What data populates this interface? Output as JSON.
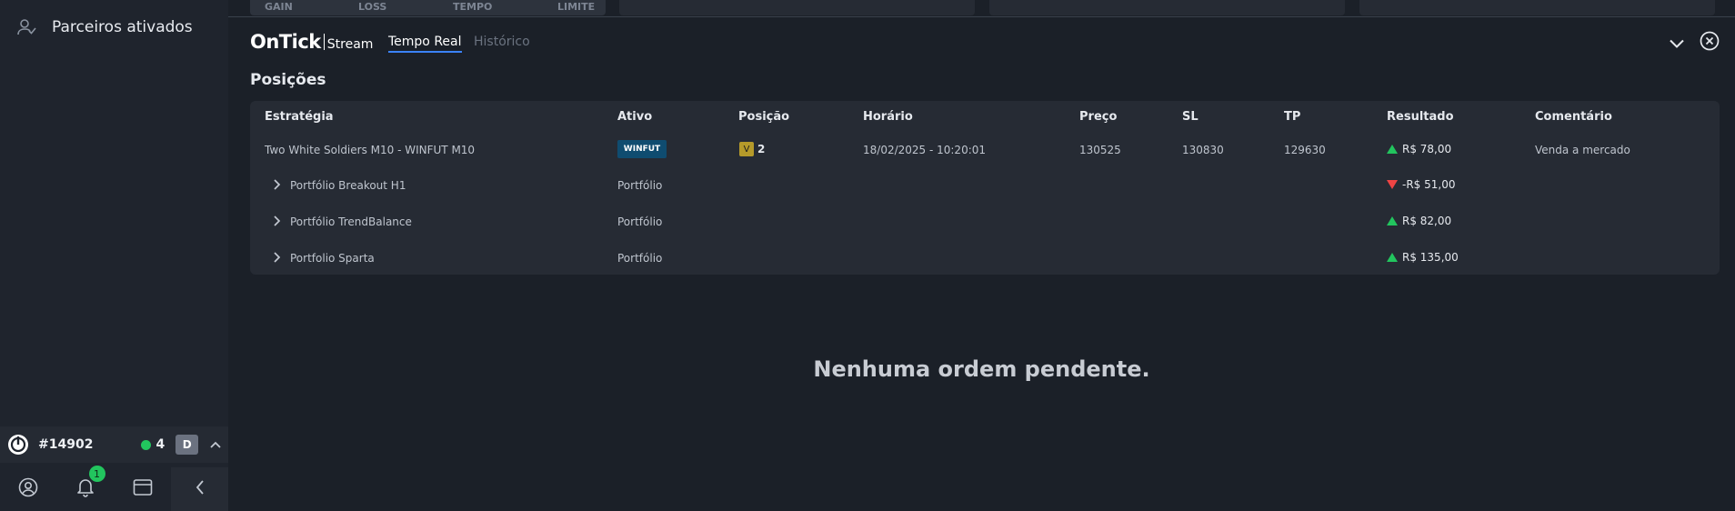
{
  "sidebar": {
    "partners_label": "Parceiros ativados",
    "account_id": "#14902",
    "connections": "4",
    "account_badge": "D",
    "notifications": "1"
  },
  "top_strip": {
    "labels": [
      "GAIN",
      "LOSS",
      "TEMPO",
      "LIMITE"
    ]
  },
  "header": {
    "brand_main": "OnTick",
    "brand_sub": "Stream",
    "tab_realtime": "Tempo Real",
    "tab_history": "Histórico"
  },
  "section_title": "Posições",
  "table": {
    "columns": [
      "Estratégia",
      "Ativo",
      "Posição",
      "Horário",
      "Preço",
      "SL",
      "TP",
      "Resultado",
      "Comentário"
    ],
    "main_row": {
      "strategy": "Two White Soldiers M10 - WINFUT M10",
      "asset": "WINFUT",
      "side": "V",
      "qty": "2",
      "time": "18/02/2025 - 10:20:01",
      "price": "130525",
      "sl": "130830",
      "tp": "129630",
      "result": "R$ 78,00",
      "comment": "Venda a mercado"
    },
    "portfolio_rows": [
      {
        "name": "Portfólio Breakout H1",
        "asset": "Portfólio",
        "result": "-R$ 51,00",
        "direction": "down"
      },
      {
        "name": "Portfólio TrendBalance",
        "asset": "Portfólio",
        "result": "R$ 82,00",
        "direction": "up"
      },
      {
        "name": "Portfolio Sparta",
        "asset": "Portfólio",
        "result": "R$ 135,00",
        "direction": "up"
      }
    ]
  },
  "empty_message": "Nenhuma ordem pendente.",
  "colors": {
    "accent": "#3b82f6",
    "positive": "#22c55e",
    "negative": "#ef4444",
    "asset_tag": "#0f4c70"
  }
}
